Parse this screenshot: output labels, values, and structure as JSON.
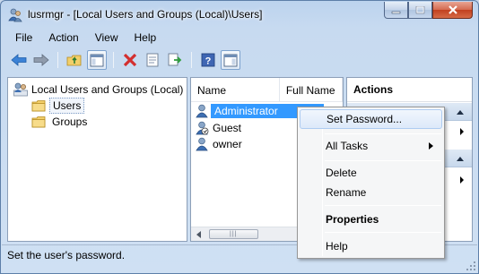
{
  "window": {
    "title": "lusrmgr - [Local Users and Groups (Local)\\Users]"
  },
  "menubar": {
    "items": [
      "File",
      "Action",
      "View",
      "Help"
    ]
  },
  "toolbar": {
    "buttons": [
      "back-icon",
      "forward-icon",
      "up-folder-icon",
      "show-hide-tree-icon",
      "delete-icon",
      "properties-icon",
      "export-list-icon",
      "help-icon",
      "show-hide-action-pane-icon"
    ]
  },
  "tree": {
    "root": "Local Users and Groups (Local)",
    "children": [
      {
        "label": "Users",
        "selected": true
      },
      {
        "label": "Groups",
        "selected": false
      }
    ]
  },
  "list": {
    "columns": [
      "Name",
      "Full Name"
    ],
    "rows": [
      {
        "name": "Administrator",
        "selected": true
      },
      {
        "name": "Guest",
        "selected": false
      },
      {
        "name": "owner",
        "selected": false
      }
    ],
    "scroll_grip": "|||"
  },
  "actions": {
    "header": "Actions"
  },
  "context_menu": {
    "items": [
      {
        "label": "Set Password...",
        "highlighted": true,
        "bold": false,
        "submenu": false
      },
      {
        "label": "All Tasks",
        "highlighted": false,
        "bold": false,
        "submenu": true
      },
      {
        "label": "Delete",
        "highlighted": false,
        "bold": false,
        "submenu": false
      },
      {
        "label": "Rename",
        "highlighted": false,
        "bold": false,
        "submenu": false
      },
      {
        "label": "Properties",
        "highlighted": false,
        "bold": true,
        "submenu": false
      },
      {
        "label": "Help",
        "highlighted": false,
        "bold": false,
        "submenu": false
      }
    ]
  },
  "statusbar": {
    "text": "Set the user's password."
  },
  "colors": {
    "selection": "#3399ff",
    "frame": "#c9d8ec",
    "close_button": "#c1401f"
  }
}
